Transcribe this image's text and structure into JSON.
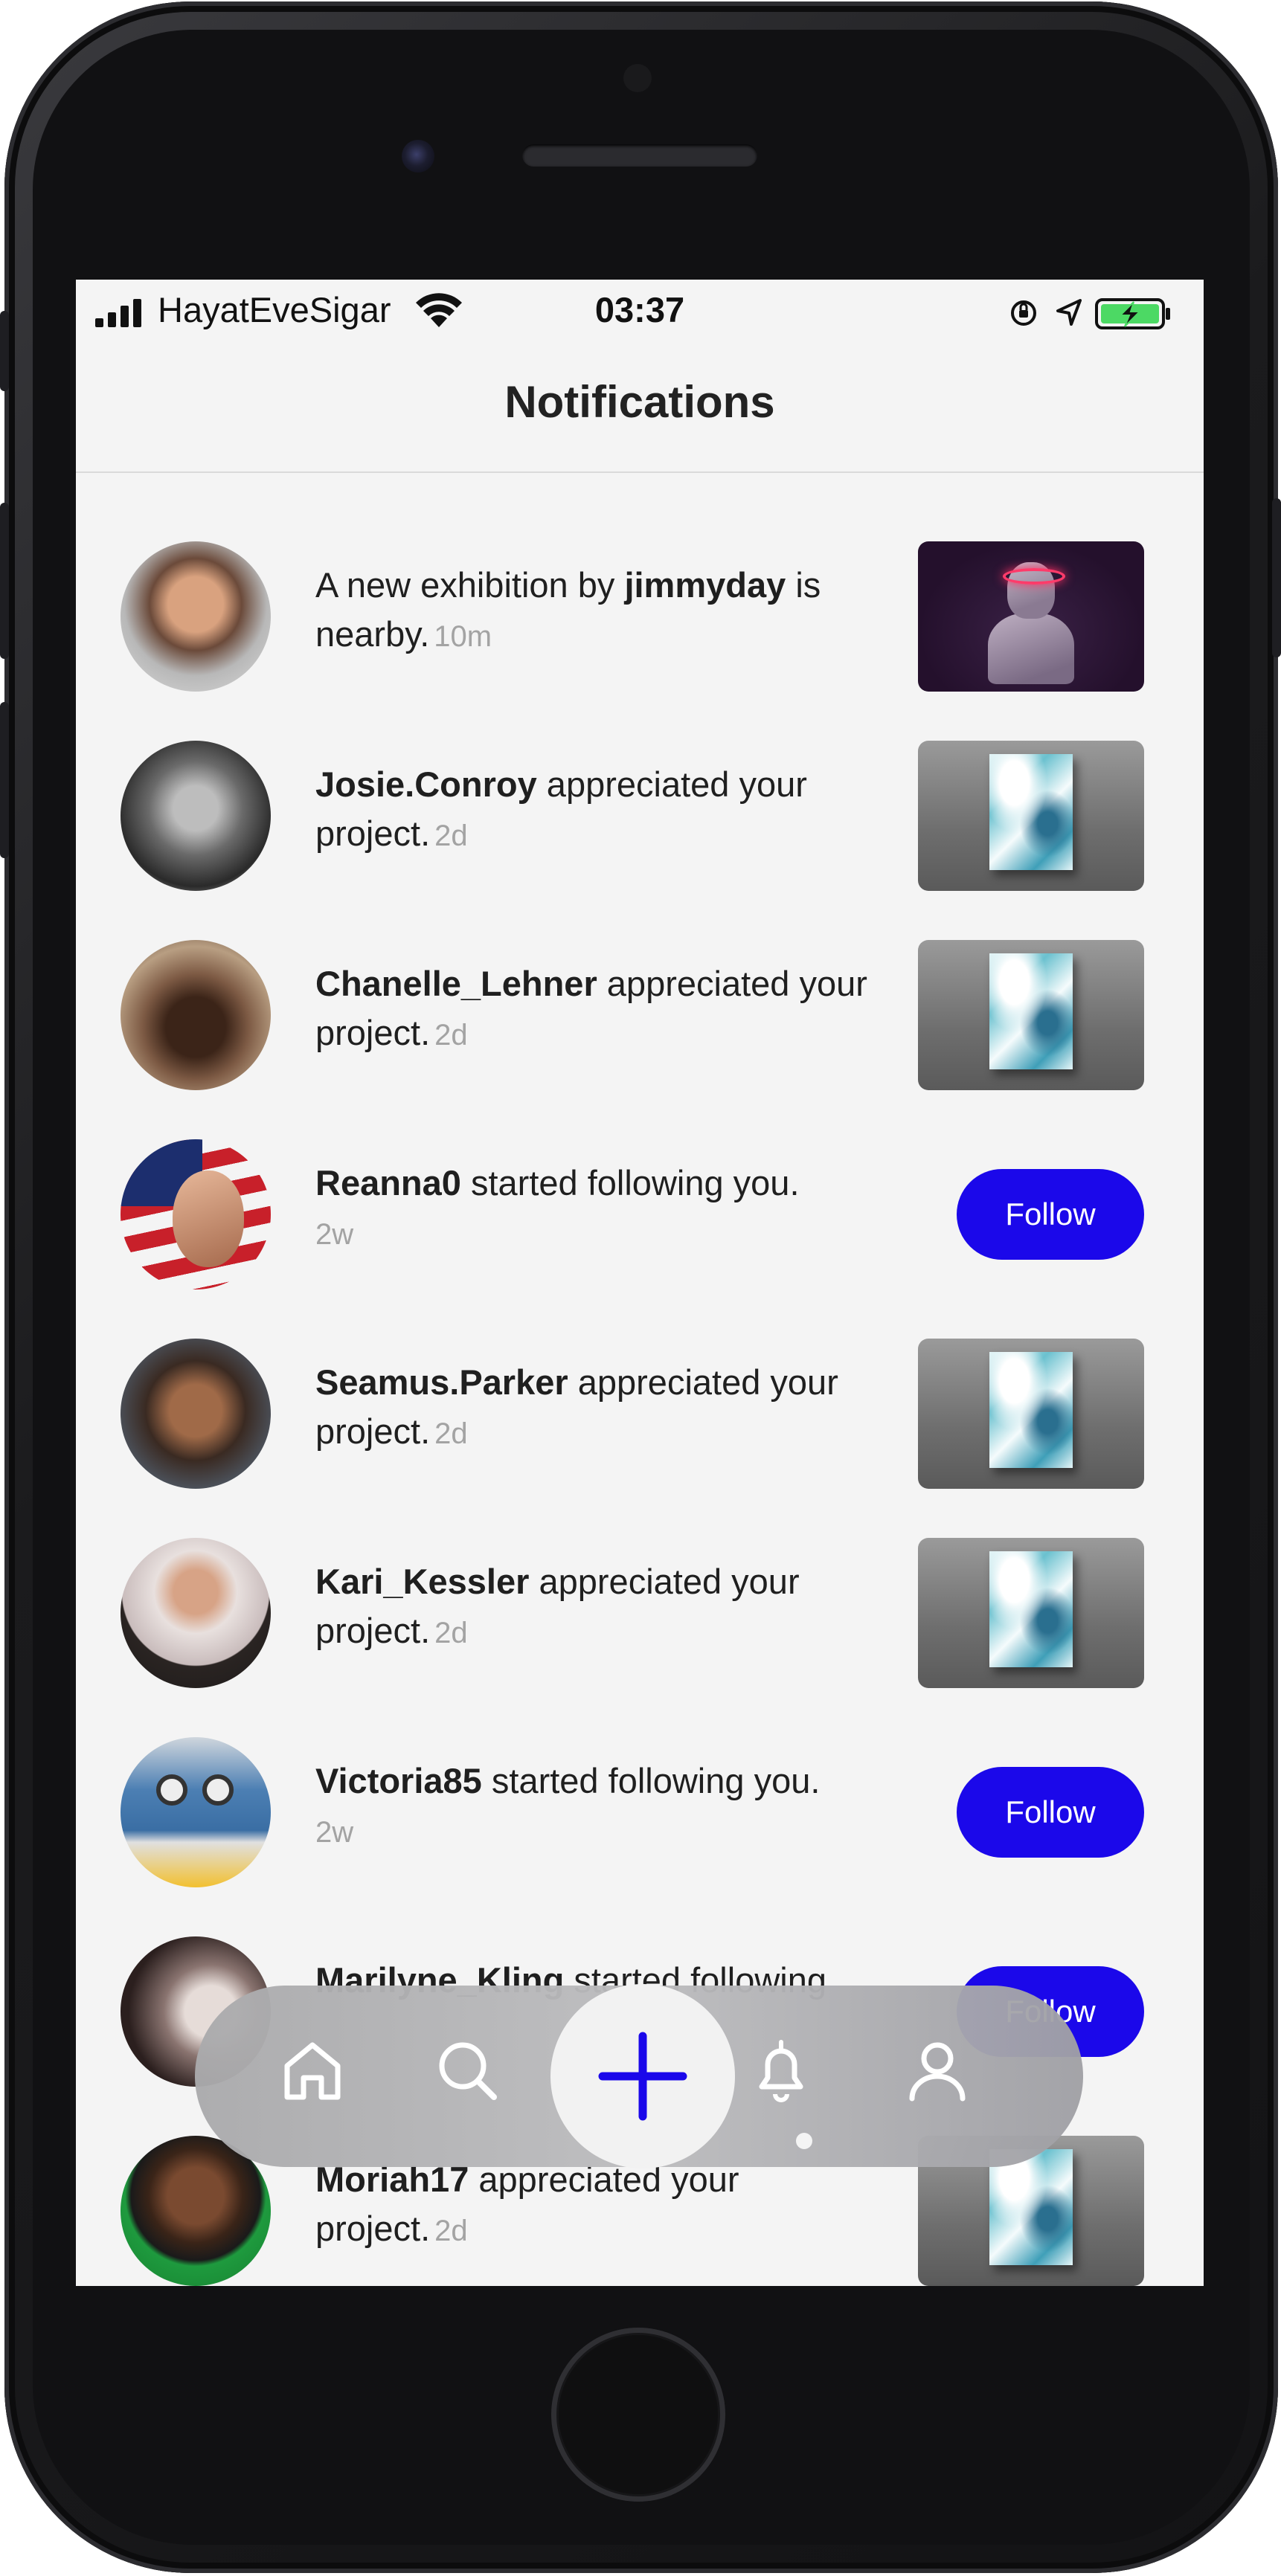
{
  "status_bar": {
    "carrier": "HayatEveSigar",
    "time": "03:37"
  },
  "nav": {
    "title": "Notifications"
  },
  "notifications": [
    {
      "prefix": "A new exhibition by ",
      "user": "jimmyday",
      "text": " is nearby.",
      "time": "10m",
      "action": "thumbnail-exhibition"
    },
    {
      "prefix": "",
      "user": "Josie.Conroy",
      "text": " appreciated your project.",
      "time": "2d",
      "action": "thumbnail-project"
    },
    {
      "prefix": "",
      "user": "Chanelle_Lehner",
      "text": " appreciated your project.",
      "time": "2d",
      "action": "thumbnail-project"
    },
    {
      "prefix": "",
      "user": "Reanna0",
      "text": " started following you.",
      "time": "2w",
      "action": "follow"
    },
    {
      "prefix": "",
      "user": "Seamus.Parker",
      "text": " appreciated your project.",
      "time": "2d",
      "action": "thumbnail-project"
    },
    {
      "prefix": "",
      "user": "Kari_Kessler",
      "text": " appreciated your project.",
      "time": "2d",
      "action": "thumbnail-project"
    },
    {
      "prefix": "",
      "user": "Victoria85",
      "text": " started following you.",
      "time": "2w",
      "action": "follow"
    },
    {
      "prefix": "",
      "user": "Marilyne_Kling",
      "text": " started following",
      "time": "",
      "action": "follow"
    },
    {
      "prefix": "",
      "user": "Moriah17",
      "text": " appreciated your project.",
      "time": "2d",
      "action": "thumbnail-project"
    }
  ],
  "follow_label": "Follow",
  "tabbar": {
    "items": [
      "home-icon",
      "search-icon",
      "add-icon",
      "bell-icon",
      "profile-icon"
    ],
    "accent": "#1b08ea"
  }
}
